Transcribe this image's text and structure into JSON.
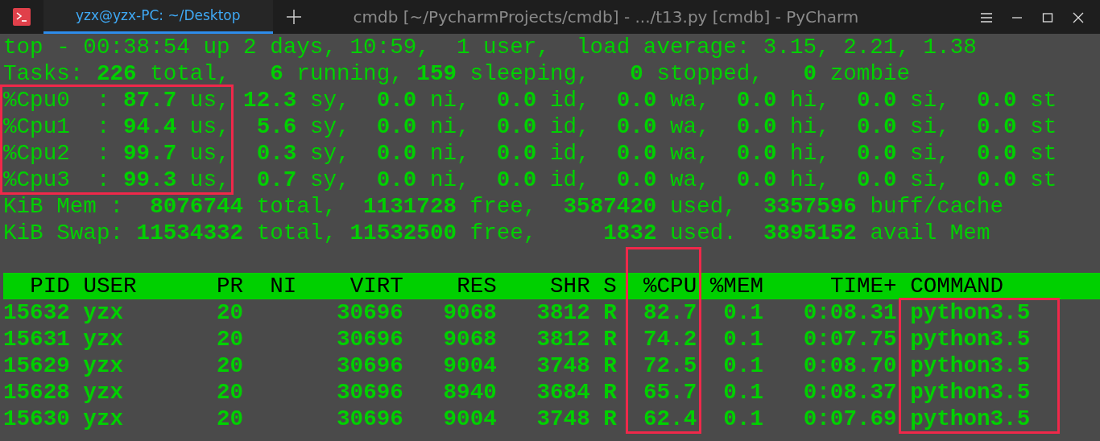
{
  "window": {
    "title": "cmdb [~/PycharmProjects/cmdb] - .../t13.py [cmdb] - PyCharm"
  },
  "tabs": [
    {
      "label": "yzx@yzx-PC: ~/Desktop",
      "selected": true
    }
  ],
  "summary_lines": [
    "top - 00:38:54 up 2 days, 10:59,  1 user,  load average: 3.15, 2.21, 1.38",
    "Tasks: **226** total,   **6** running, **159** sleeping,   **0** stopped,   **0** zombie",
    "%Cpu0  : **87.7** us, **12.3** sy,  **0.0** ni,  **0.0** id,  **0.0** wa,  **0.0** hi,  **0.0** si,  **0.0** st",
    "%Cpu1  : **94.4** us,  **5.6** sy,  **0.0** ni,  **0.0** id,  **0.0** wa,  **0.0** hi,  **0.0** si,  **0.0** st",
    "%Cpu2  : **99.7** us,  **0.3** sy,  **0.0** ni,  **0.0** id,  **0.0** wa,  **0.0** hi,  **0.0** si,  **0.0** st",
    "%Cpu3  : **99.3** us,  **0.7** sy,  **0.0** ni,  **0.0** id,  **0.0** wa,  **0.0** hi,  **0.0** si,  **0.0** st",
    "KiB Mem :  **8076744** total,  **1131728** free,  **3587420** used,  **3357596** buff/cache",
    "KiB Swap: **11534332** total, **11532500** free,     **1832** used.  **3895152** avail Mem"
  ],
  "process_table": {
    "columns": [
      "PID",
      "USER",
      "PR",
      "NI",
      "VIRT",
      "RES",
      "SHR",
      "S",
      "%CPU",
      "%MEM",
      "TIME+",
      "COMMAND"
    ],
    "rows": [
      [
        "15632",
        "yzx",
        "20",
        "",
        "30696",
        "9068",
        "3812",
        "R",
        "82.7",
        "0.1",
        "0:08.31",
        "python3.5"
      ],
      [
        "15631",
        "yzx",
        "20",
        "",
        "30696",
        "9068",
        "3812",
        "R",
        "74.2",
        "0.1",
        "0:07.75",
        "python3.5"
      ],
      [
        "15629",
        "yzx",
        "20",
        "",
        "30696",
        "9004",
        "3748",
        "R",
        "72.5",
        "0.1",
        "0:08.70",
        "python3.5"
      ],
      [
        "15628",
        "yzx",
        "20",
        "",
        "30696",
        "8940",
        "3684",
        "R",
        "65.7",
        "0.1",
        "0:08.37",
        "python3.5"
      ],
      [
        "15630",
        "yzx",
        "20",
        "",
        "30696",
        "9004",
        "3748",
        "R",
        "62.4",
        "0.1",
        "0:07.69",
        "python3.5"
      ]
    ]
  }
}
